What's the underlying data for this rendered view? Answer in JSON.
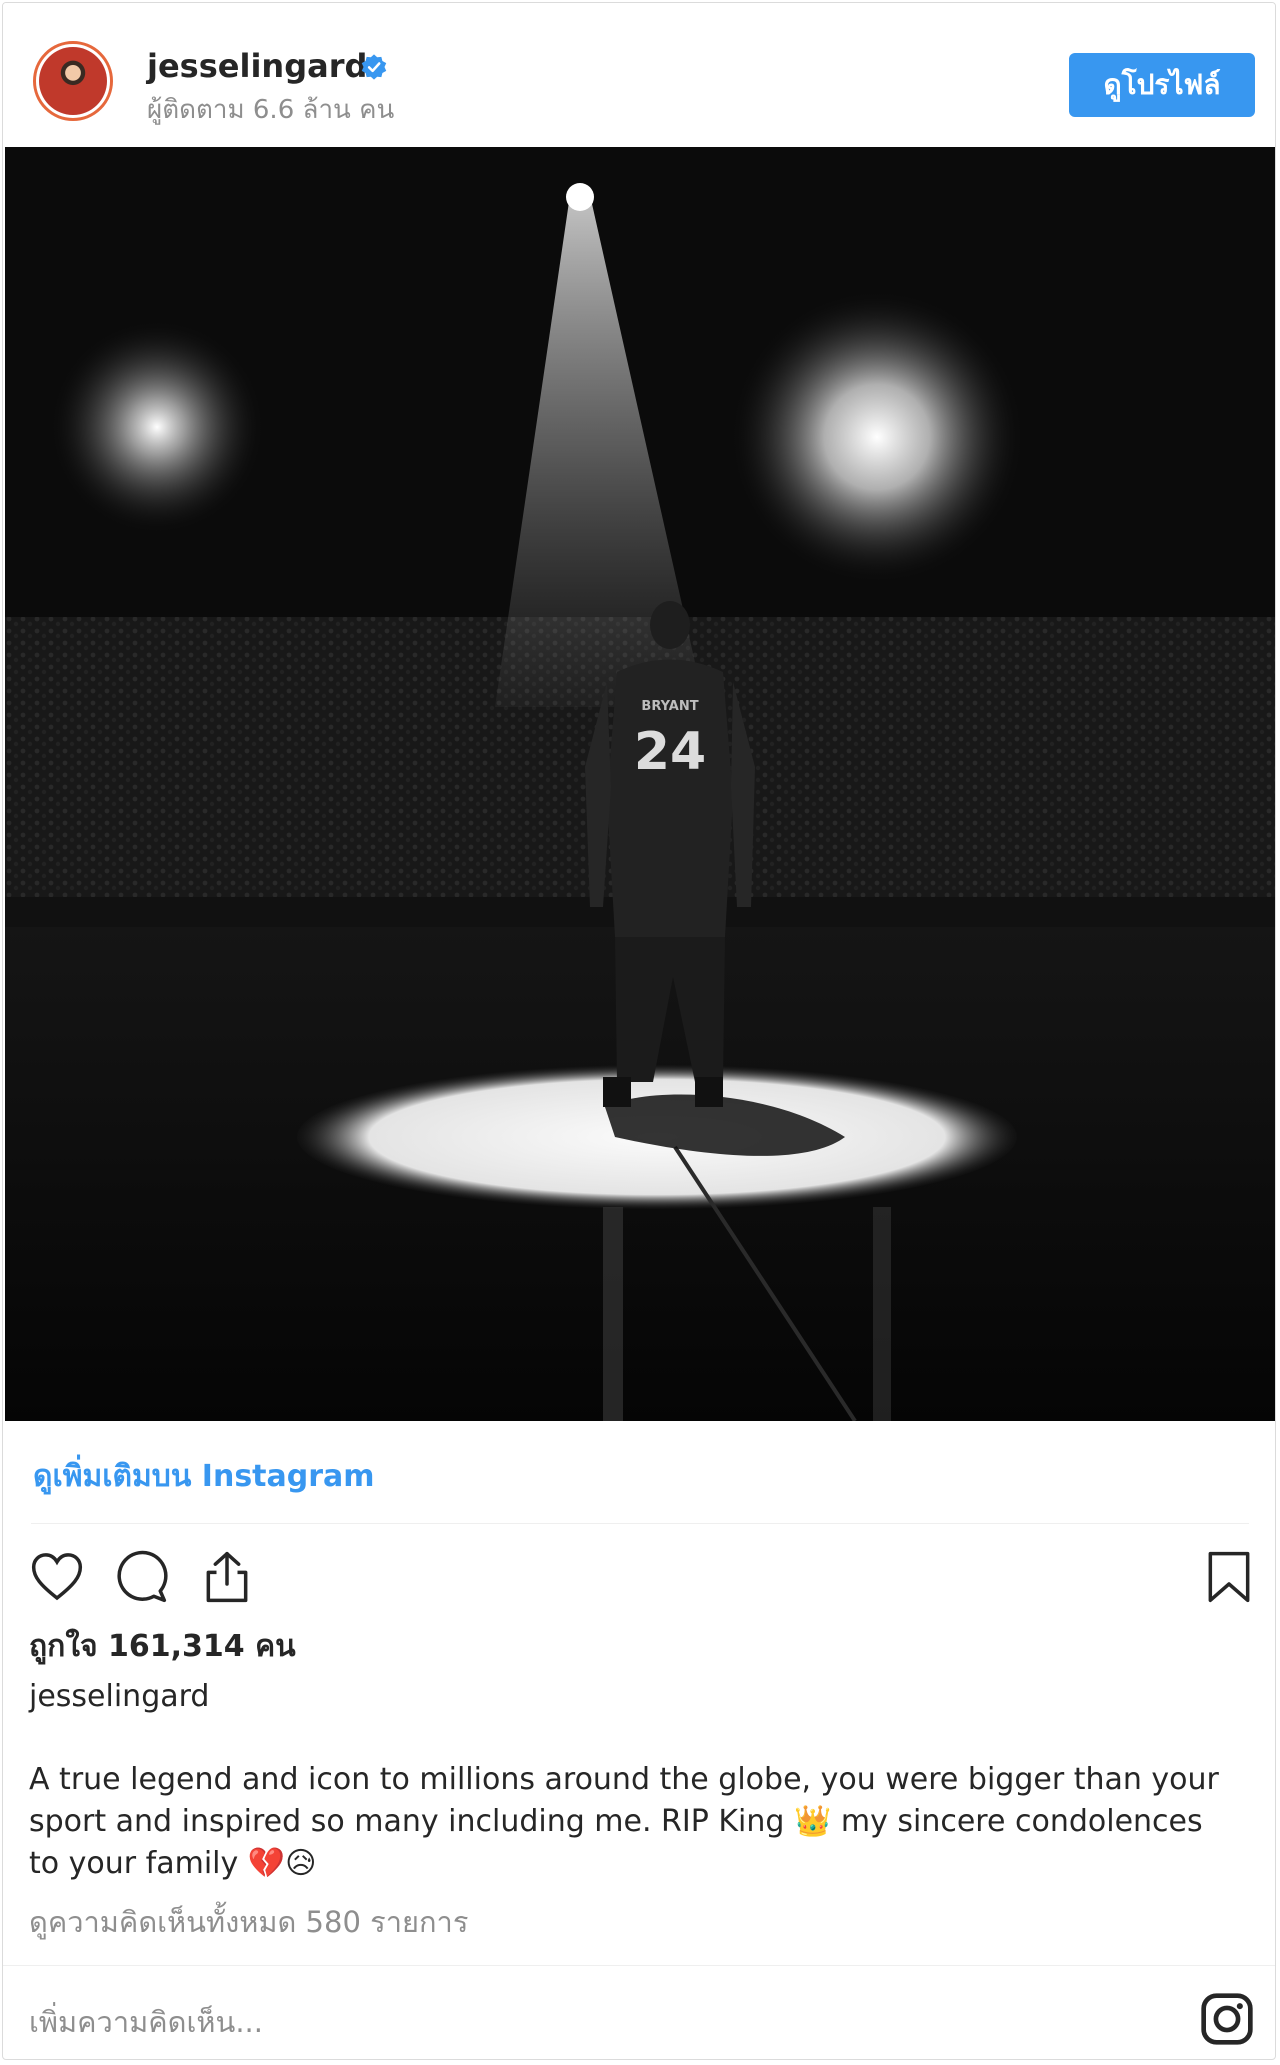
{
  "header": {
    "username": "jesselingard",
    "followers_text": "ผู้ติดตาม 6.6 ล้าน คน",
    "view_profile_label": "ดูโปรไฟล์"
  },
  "photo": {
    "jersey_name": "BRYANT",
    "jersey_number": "24"
  },
  "footer": {
    "view_more_label": "ดูเพิ่มเติมบน Instagram",
    "likes_text": "ถูกใจ 161,314 คน",
    "caption_username": "jesselingard",
    "caption_text": "A true legend and icon to millions around the globe, you were bigger than your sport and inspired so many including me. RIP King 👑 my sincere condolences to your family 💔😥",
    "view_comments_label": "ดูความคิดเห็นทั้งหมด 580 รายการ",
    "add_comment_placeholder": "เพิ่มความคิดเห็น..."
  },
  "icons": {
    "like": "heart-icon",
    "comment": "comment-icon",
    "share": "share-icon",
    "save": "bookmark-icon",
    "instagram": "instagram-icon",
    "verified": "verified-badge-icon"
  },
  "colors": {
    "accent": "#3897f0",
    "verified": "#3897f0",
    "muted_text": "#8e8e8e"
  }
}
